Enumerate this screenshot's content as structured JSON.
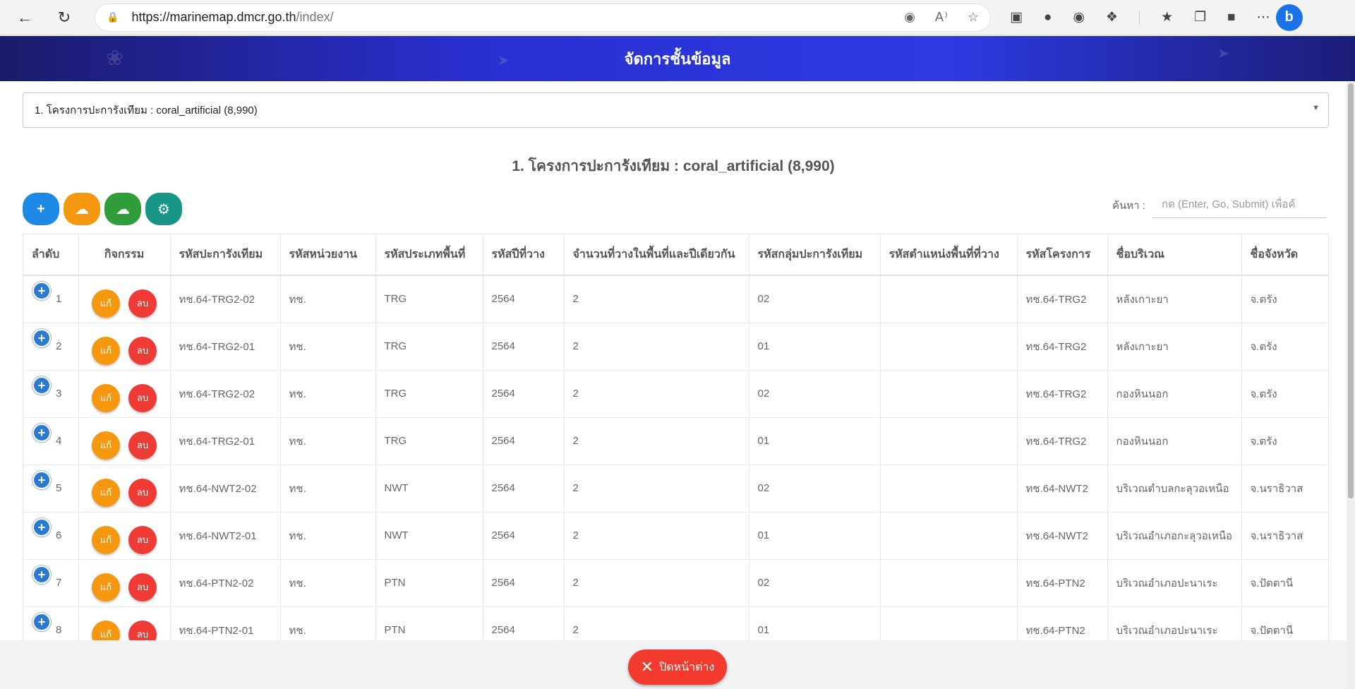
{
  "browser": {
    "url_host": "https://marinemap.dmcr.go.th",
    "url_path": "/index/"
  },
  "banner": {
    "title": "จัดการชั้นข้อมูล"
  },
  "layer_select": {
    "value": "1. โครงการปะการังเทียม : coral_artificial (8,990)"
  },
  "layer_title": "1. โครงการปะการังเทียม : coral_artificial (8,990)",
  "search": {
    "label": "ค้นหา :",
    "placeholder": "กด (Enter, Go, Submit) เพื่อค้"
  },
  "table": {
    "headers": [
      "ลำดับ",
      "กิจกรรม",
      "รหัสปะการังเทียม",
      "รหัสหน่วยงาน",
      "รหัสประเภทพื้นที่",
      "รหัสปีที่วาง",
      "จำนวนที่วางในพื้นที่และปีเดียวกัน",
      "รหัสกลุ่มปะการังเทียม",
      "รหัสตำแหน่งพื้นที่ที่วาง",
      "รหัสโครงการ",
      "ชื่อบริเวณ",
      "ชื่อจังหวัด"
    ],
    "edit_label": "แก้",
    "delete_label": "ลบ",
    "rows": [
      {
        "idx": "1",
        "code": "ทช.64-TRG2-02",
        "agency": "ทช.",
        "area_type": "TRG",
        "year": "2564",
        "count": "2",
        "group": "02",
        "position": "",
        "project": "ทช.64-TRG2",
        "place": "หลังเกาะยา",
        "province": "จ.ตรัง"
      },
      {
        "idx": "2",
        "code": "ทช.64-TRG2-01",
        "agency": "ทช.",
        "area_type": "TRG",
        "year": "2564",
        "count": "2",
        "group": "01",
        "position": "",
        "project": "ทช.64-TRG2",
        "place": "หลังเกาะยา",
        "province": "จ.ตรัง"
      },
      {
        "idx": "3",
        "code": "ทช.64-TRG2-02",
        "agency": "ทช.",
        "area_type": "TRG",
        "year": "2564",
        "count": "2",
        "group": "02",
        "position": "",
        "project": "ทช.64-TRG2",
        "place": "กองหินนอก",
        "province": "จ.ตรัง"
      },
      {
        "idx": "4",
        "code": "ทช.64-TRG2-01",
        "agency": "ทช.",
        "area_type": "TRG",
        "year": "2564",
        "count": "2",
        "group": "01",
        "position": "",
        "project": "ทช.64-TRG2",
        "place": "กองหินนอก",
        "province": "จ.ตรัง"
      },
      {
        "idx": "5",
        "code": "ทช.64-NWT2-02",
        "agency": "ทช.",
        "area_type": "NWT",
        "year": "2564",
        "count": "2",
        "group": "02",
        "position": "",
        "project": "ทช.64-NWT2",
        "place": "บริเวณตำบลกะลุวอเหนือ",
        "province": "จ.นราธิวาส"
      },
      {
        "idx": "6",
        "code": "ทช.64-NWT2-01",
        "agency": "ทช.",
        "area_type": "NWT",
        "year": "2564",
        "count": "2",
        "group": "01",
        "position": "",
        "project": "ทช.64-NWT2",
        "place": "บริเวณอำเภอกะลุวอเหนือ",
        "province": "จ.นราธิวาส"
      },
      {
        "idx": "7",
        "code": "ทช.64-PTN2-02",
        "agency": "ทช.",
        "area_type": "PTN",
        "year": "2564",
        "count": "2",
        "group": "02",
        "position": "",
        "project": "ทช.64-PTN2",
        "place": "บริเวณอำเภอปะนาเระ",
        "province": "จ.ปัตตานี"
      },
      {
        "idx": "8",
        "code": "ทช.64-PTN2-01",
        "agency": "ทช.",
        "area_type": "PTN",
        "year": "2564",
        "count": "2",
        "group": "01",
        "position": "",
        "project": "ทช.64-PTN2",
        "place": "บริเวณอำเภอปะนาเระ",
        "province": "จ.ปัตตานี"
      }
    ]
  },
  "close_button": {
    "label": "ปิดหน้าต่าง"
  },
  "colors": {
    "banner": "#2a2fd0",
    "add": "#1e88e5",
    "download": "#f5980f",
    "upload": "#2e9d3a",
    "settings": "#1a9688",
    "edit": "#f5980f",
    "delete": "#ef3b36",
    "close": "#f23b2e"
  },
  "icons": {
    "add": "plus-icon",
    "download": "cloud-download-icon",
    "upload": "cloud-upload-icon",
    "settings": "gear-icon",
    "close": "close-icon",
    "expand": "plus-circle-icon"
  }
}
